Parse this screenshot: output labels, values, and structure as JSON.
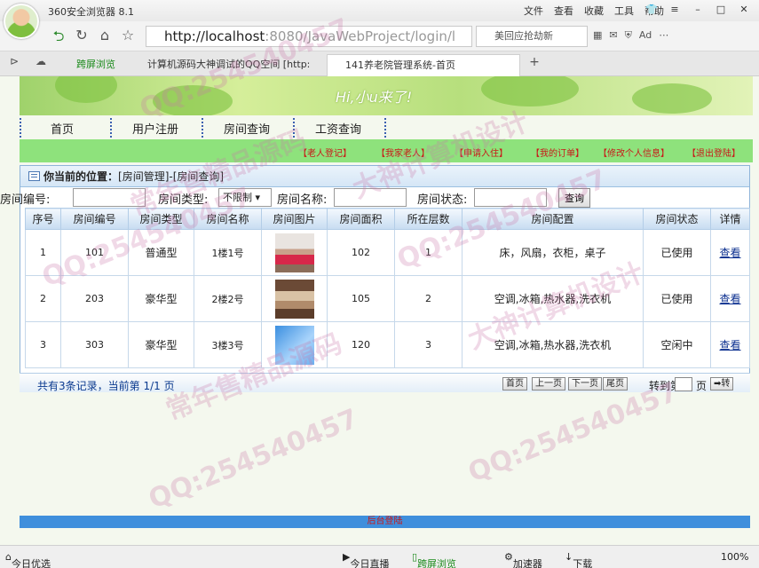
{
  "browser": {
    "title": "360安全浏览器 8.1",
    "menu": [
      "文件",
      "查看",
      "收藏",
      "工具",
      "帮助"
    ],
    "url_host": "http://localhost",
    "url_path": ":8080/JavaWebProject/login/l",
    "search_text": "美回应抢劫新",
    "tabs": [
      "跨屏浏览",
      "计算机源码大神调试的QQ空间 [http:",
      "141养老院管理系统-首页"
    ]
  },
  "banner": {
    "greeting": "Hi,小u来了!"
  },
  "nav": [
    "首页",
    "用户注册",
    "房间查询",
    "工资查询"
  ],
  "subnav": [
    "【老人登记】",
    "【我家老人】",
    "【申请入住】",
    "【我的订单】",
    "【修改个人信息】",
    "【退出登陆】"
  ],
  "breadcrumb": {
    "prefix": "你当前的位置：",
    "path": "[房间管理]-[房间查询]"
  },
  "filters": {
    "room_no_label": "房间编号:",
    "room_type_label": "房间类型:",
    "room_type_value": "不限制",
    "room_name_label": "房间名称:",
    "room_status_label": "房间状态:",
    "query_button": "查询"
  },
  "table": {
    "headers": [
      "序号",
      "房间编号",
      "房间类型",
      "房间名称",
      "房间图片",
      "房间面积",
      "所在层数",
      "房间配置",
      "房间状态",
      "详情"
    ],
    "rows": [
      {
        "seq": "1",
        "no": "101",
        "type": "普通型",
        "name": "1楼1号",
        "area": "102",
        "floor": "1",
        "config": "床，风扇，衣柜，桌子",
        "status": "已使用",
        "detail": "查看"
      },
      {
        "seq": "2",
        "no": "203",
        "type": "豪华型",
        "name": "2楼2号",
        "area": "105",
        "floor": "2",
        "config": "空调,冰箱,热水器,洗衣机",
        "status": "已使用",
        "detail": "查看"
      },
      {
        "seq": "3",
        "no": "303",
        "type": "豪华型",
        "name": "3楼3号",
        "area": "120",
        "floor": "3",
        "config": "空调,冰箱,热水器,洗衣机",
        "status": "空闲中",
        "detail": "查看"
      }
    ]
  },
  "pagination": {
    "info": "共有3条记录，当前第 1/1 页",
    "first": "首页",
    "prev": "上一页",
    "next": "下一页",
    "last": "尾页",
    "goto_label": "转到第",
    "page_unit": "页",
    "go_button": "➡转"
  },
  "footer_link": "后台登陆",
  "statusbar": [
    "今日优选",
    "今日直播",
    "跨屏浏览",
    "加速器",
    "下载",
    "100%"
  ],
  "watermarks": [
    "QQ:254540457",
    "常年售精品源码",
    "大神计算机设计"
  ],
  "colors": {
    "subnav_bg": "#8ee27c",
    "subnav_text": "#c81818",
    "link": "#0b2f8f",
    "footer_bar": "#3f8fdc"
  }
}
